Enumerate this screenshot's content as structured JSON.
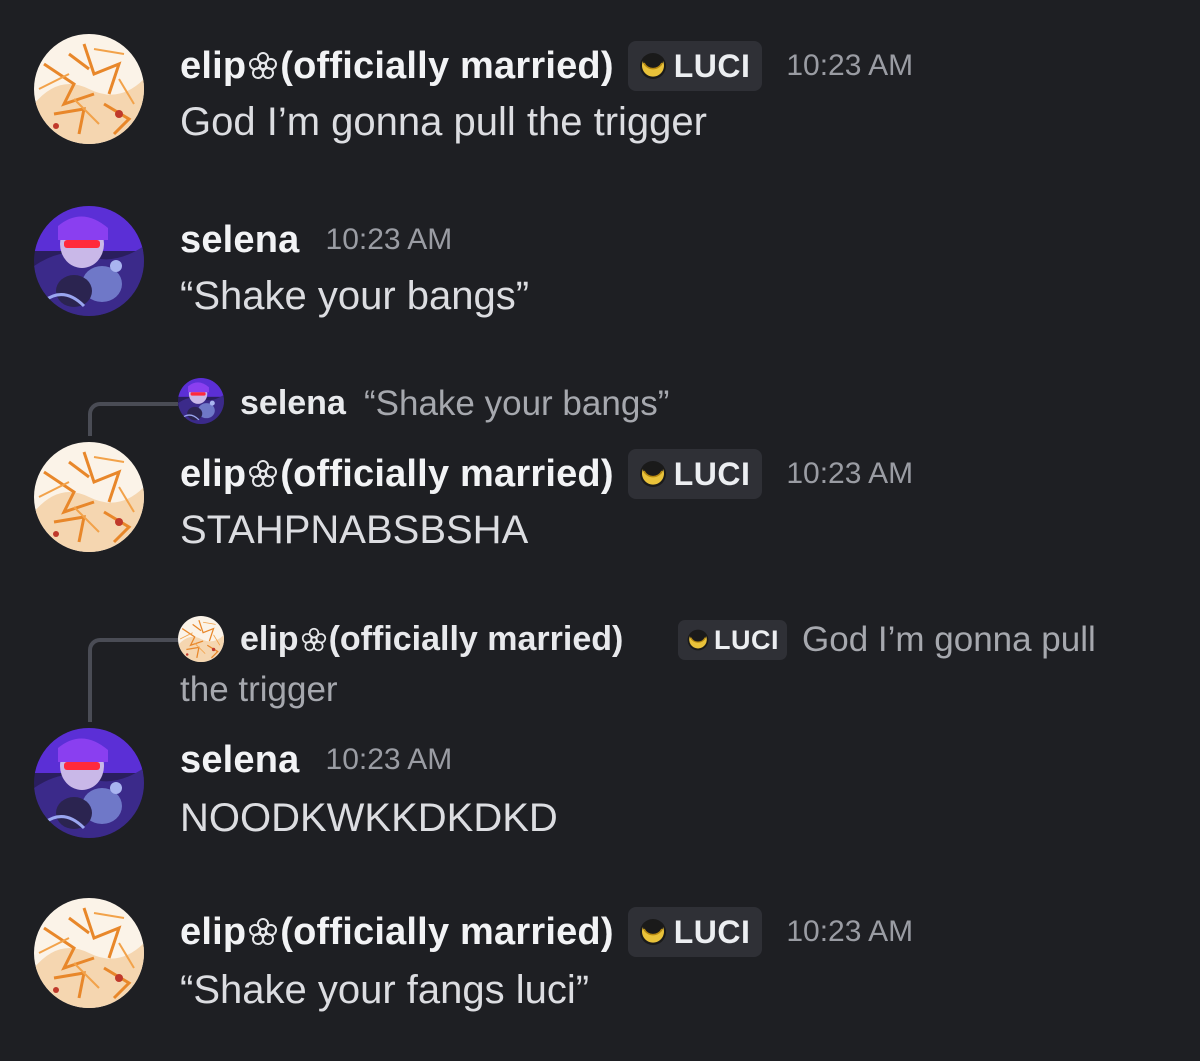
{
  "users": {
    "elip": {
      "name_prefix": "elip",
      "name_suffix": " (officially married)",
      "tag": "LUCI",
      "avatar_icon": "elip-avatar",
      "tag_icon": "moon-badge-icon"
    },
    "selena": {
      "name": "selena",
      "avatar_icon": "selena-avatar"
    }
  },
  "messages": [
    {
      "author": "elip",
      "time": "10:23 AM",
      "text": "God I’m gonna pull the trigger"
    },
    {
      "author": "selena",
      "time": "10:23 AM",
      "text": "“Shake your bangs”"
    },
    {
      "author": "elip",
      "time": "10:23 AM",
      "text": "STAHPNABSBSHA",
      "reply": {
        "author": "selena",
        "text": "“Shake your bangs”"
      }
    },
    {
      "author": "selena",
      "time": "10:23 AM",
      "text": "NOODKWKKDKDKD",
      "reply": {
        "author": "elip",
        "text_line1": "God I’m gonna pull",
        "text_line2": "the trigger"
      }
    },
    {
      "author": "elip",
      "time": "10:23 AM",
      "text": "“Shake your fangs luci”"
    }
  ],
  "colors": {
    "background": "#1e1f23",
    "username": "#f2f3f5",
    "timestamp": "#9a9ca3",
    "message": "#dcdde1",
    "tag_bg": "#2f3036",
    "reply_line": "#4a4c55"
  }
}
